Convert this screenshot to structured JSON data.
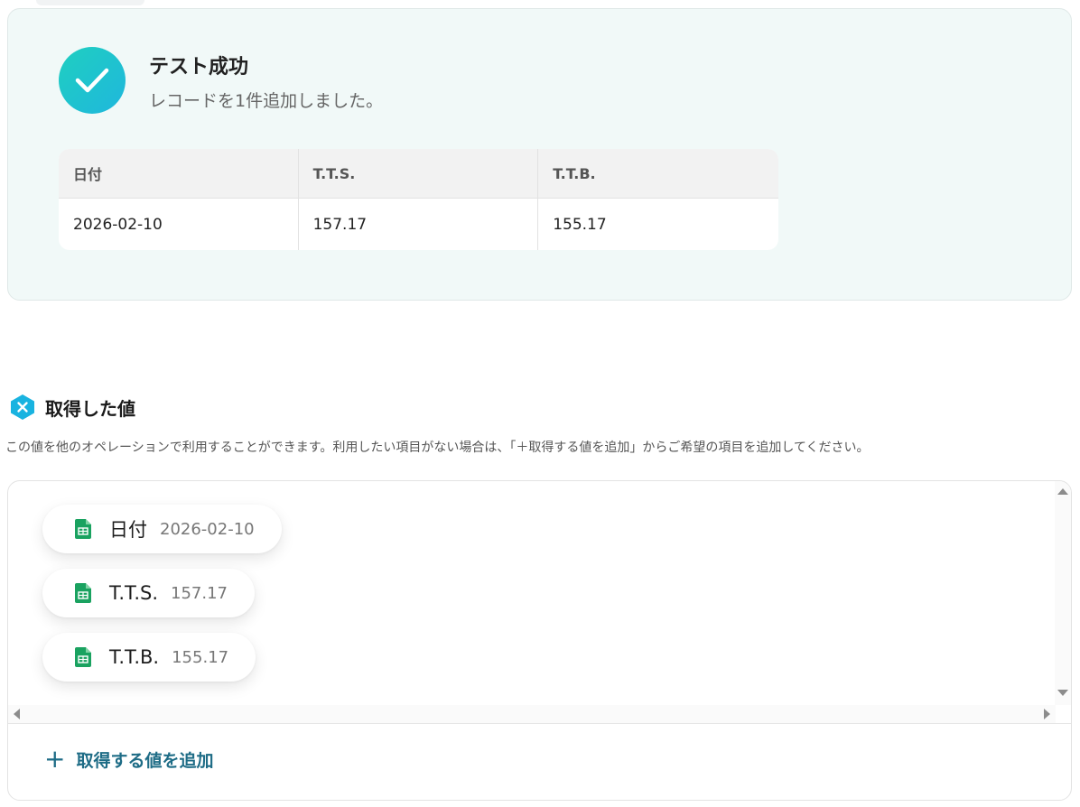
{
  "result": {
    "title": "テスト成功",
    "subtitle": "レコードを1件追加しました。",
    "table": {
      "headers": [
        "日付",
        "T.T.S.",
        "T.T.B."
      ],
      "rows": [
        [
          "2026-02-10",
          "157.17",
          "155.17"
        ]
      ]
    }
  },
  "values_section": {
    "title": "取得した値",
    "description": "この値を他のオペレーションで利用することができます。利用したい項目がない場合は、「＋取得する値を追加」からご希望の項目を追加してください。",
    "items": [
      {
        "label": "日付",
        "value": "2026-02-10",
        "icon": "spreadsheet-icon"
      },
      {
        "label": "T.T.S.",
        "value": "157.17",
        "icon": "spreadsheet-icon"
      },
      {
        "label": "T.T.B.",
        "value": "155.17",
        "icon": "spreadsheet-icon"
      }
    ],
    "add_button": {
      "plus": "+",
      "label": "取得する値を追加"
    }
  },
  "colors": {
    "success_gradient_start": "#1fcfc0",
    "success_gradient_end": "#1fb7dd",
    "panel_background": "#f1f9f8",
    "accent": "#1e6c86",
    "sheet_green": "#1aa260"
  }
}
